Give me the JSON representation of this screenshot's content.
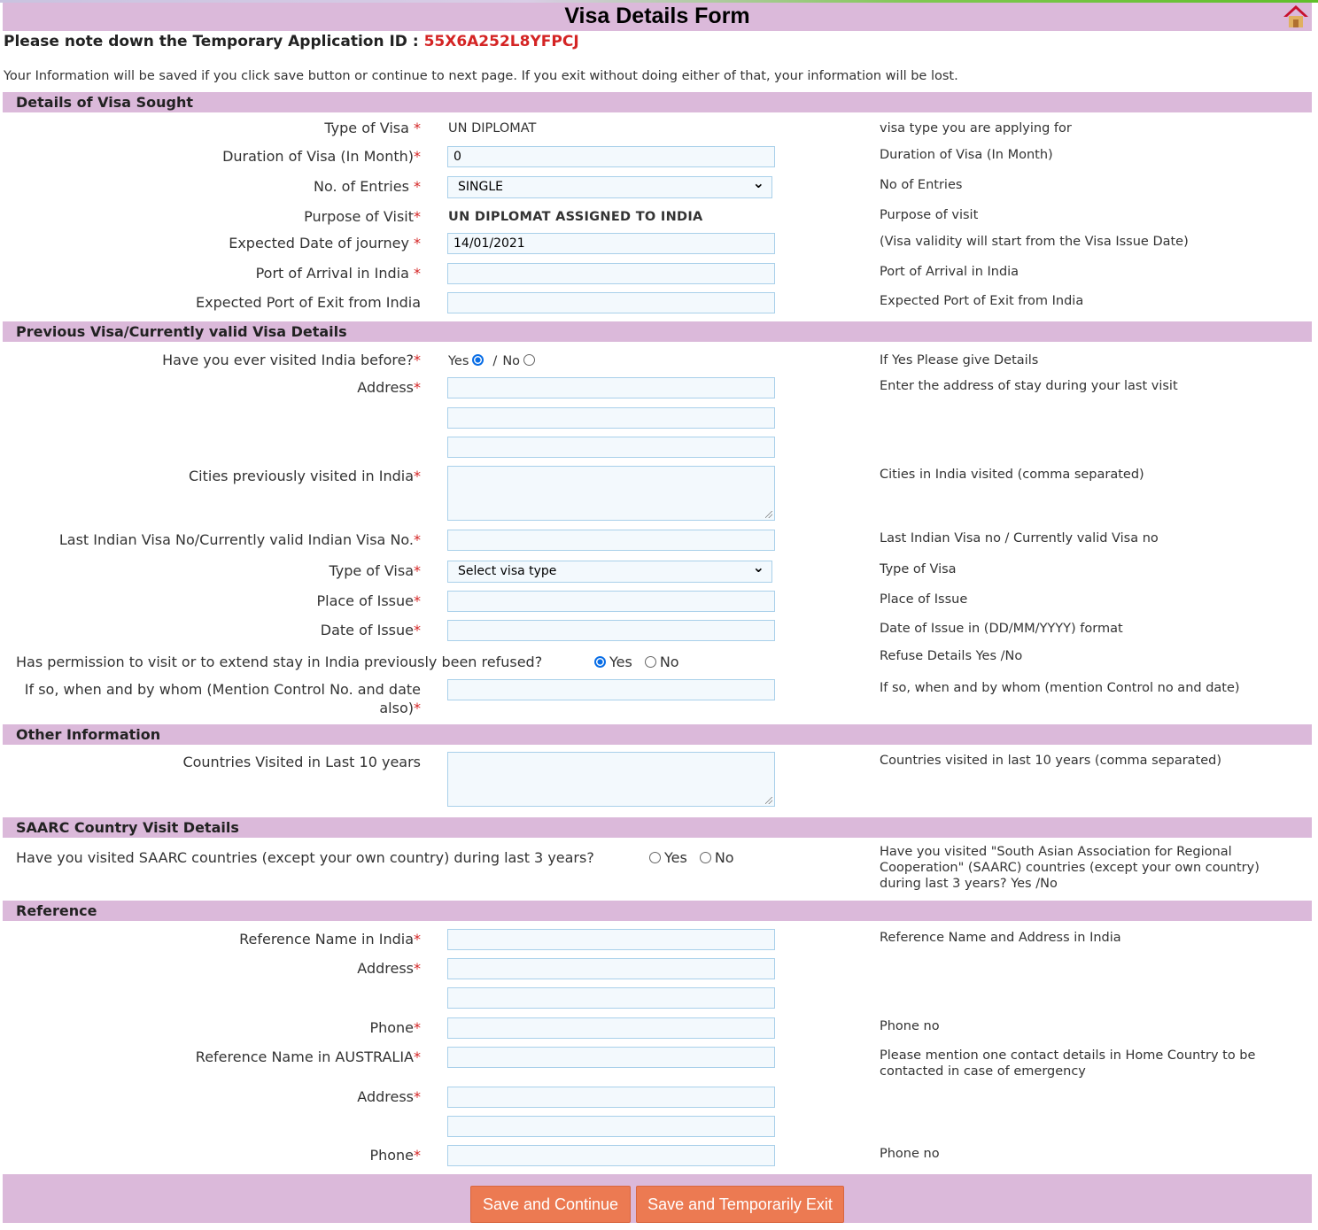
{
  "title": "Visa Details Form",
  "note": {
    "label": "Please note down the Temporary Application ID : ",
    "app_id": "55X6A252L8YFPCJ"
  },
  "info": "Your Information will be saved if you click save button or continue to next page. If you exit without doing either of that, your information will be lost.",
  "colors": {
    "header": "#dbb9da",
    "button": "#ec7a52",
    "required": "#d42424"
  },
  "sections": [
    {
      "title": "Details of Visa Sought",
      "rows": [
        {
          "label": "Type of Visa ",
          "req": "*",
          "field": {
            "type": "text",
            "value": "UN DIPLOMAT"
          },
          "help": "visa type you are applying for"
        },
        {
          "label": "Duration of Visa (In Month)",
          "req": "*",
          "field": {
            "type": "input",
            "value": "0"
          },
          "help": "Duration of Visa (In Month)"
        },
        {
          "label": "No. of Entries ",
          "req": "*",
          "field": {
            "type": "select",
            "value": "SINGLE"
          },
          "help": "No of Entries"
        },
        {
          "label": "Purpose of Visit",
          "req": "*",
          "field": {
            "type": "bold",
            "value": "UN DIPLOMAT ASSIGNED TO INDIA"
          },
          "help": "Purpose of visit"
        },
        {
          "label": "Expected Date of journey ",
          "req": "*",
          "field": {
            "type": "input",
            "value": "14/01/2021"
          },
          "help": "(Visa validity will start from the Visa Issue Date)"
        },
        {
          "label": "Port of Arrival in India ",
          "req": "*",
          "field": {
            "type": "input",
            "value": ""
          },
          "help": "Port of Arrival in India"
        },
        {
          "label": "Expected Port of Exit from India",
          "req": "",
          "field": {
            "type": "input",
            "value": ""
          },
          "help": "Expected Port of Exit from India"
        }
      ]
    },
    {
      "title": "Previous Visa/Currently valid Visa Details",
      "rows": [
        {
          "label": "Have you ever visited India before?",
          "req": "*",
          "field": {
            "type": "radio",
            "yes": "Yes",
            "no": "No",
            "sep": "/",
            "selected": "Yes"
          },
          "help": "If Yes Please give Details"
        },
        {
          "label": "Address",
          "req": "*",
          "field": {
            "type": "input",
            "value": ""
          },
          "help": "Enter the address of stay during your last visit"
        },
        {
          "label": "",
          "req": "",
          "field": {
            "type": "input",
            "value": ""
          },
          "help": ""
        },
        {
          "label": "",
          "req": "",
          "field": {
            "type": "input",
            "value": ""
          },
          "help": ""
        },
        {
          "label": "Cities previously visited in India",
          "req": "*",
          "field": {
            "type": "textarea",
            "value": ""
          },
          "help": "Cities in India visited (comma separated)"
        },
        {
          "label": "Last Indian Visa No/Currently valid Indian Visa No.",
          "req": "*",
          "field": {
            "type": "input",
            "value": ""
          },
          "help": "Last Indian Visa no / Currently valid Visa no"
        },
        {
          "label": "Type of Visa",
          "req": "*",
          "field": {
            "type": "select",
            "value": "Select visa type"
          },
          "help": "Type of Visa"
        },
        {
          "label": "Place of Issue",
          "req": "*",
          "field": {
            "type": "input",
            "value": ""
          },
          "help": "Place of Issue"
        },
        {
          "label": "Date of Issue",
          "req": "*",
          "field": {
            "type": "input",
            "value": ""
          },
          "help": "Date of Issue in (DD/MM/YYYY) format"
        },
        {
          "label": "Has permission to visit or to extend stay in India previously been refused?",
          "req": "",
          "wide": true,
          "field": {
            "type": "radio2",
            "yes": "Yes",
            "no": "No",
            "selected": "Yes"
          },
          "help": "Refuse Details Yes /No"
        },
        {
          "label": "If so, when and by whom (Mention Control No. and date also)",
          "req": "*",
          "field": {
            "type": "input",
            "value": ""
          },
          "help": "If so, when and by whom (mention Control no and date)"
        }
      ]
    },
    {
      "title": "Other Information",
      "rows": [
        {
          "label": "Countries Visited in Last 10 years",
          "req": "",
          "field": {
            "type": "textarea",
            "value": ""
          },
          "help": "Countries visited in last 10 years (comma separated)"
        }
      ]
    },
    {
      "title": "SAARC Country Visit Details",
      "rows": [
        {
          "label": "Have you visited SAARC countries (except your own country) during last 3 years?",
          "req": "",
          "wide": true,
          "field": {
            "type": "radio2",
            "yes": "Yes",
            "no": "No",
            "selected": ""
          },
          "help": "Have you visited \"South Asian Association for Regional Cooperation\" (SAARC) countries (except your own country) during last 3 years? Yes /No"
        }
      ]
    },
    {
      "title": "Reference",
      "rows": [
        {
          "label": "Reference Name in India",
          "req": "*",
          "field": {
            "type": "input",
            "value": ""
          },
          "help": "Reference Name and Address in India"
        },
        {
          "label": "Address",
          "req": "*",
          "field": {
            "type": "input",
            "value": ""
          },
          "help": ""
        },
        {
          "label": "",
          "req": "",
          "field": {
            "type": "input",
            "value": ""
          },
          "help": ""
        },
        {
          "label": "Phone",
          "req": "*",
          "field": {
            "type": "input",
            "value": ""
          },
          "help": "Phone no"
        },
        {
          "label": "Reference Name in AUSTRALIA",
          "req": "*",
          "field": {
            "type": "input",
            "value": ""
          },
          "help": "Please mention one contact details in Home Country to be contacted in case of emergency"
        },
        {
          "label": "Address",
          "req": "*",
          "field": {
            "type": "input",
            "value": ""
          },
          "help": ""
        },
        {
          "label": "",
          "req": "",
          "field": {
            "type": "input",
            "value": ""
          },
          "help": ""
        },
        {
          "label": "Phone",
          "req": "*",
          "field": {
            "type": "input",
            "value": ""
          },
          "help": "Phone no"
        }
      ]
    }
  ],
  "buttons": {
    "save_continue": "Save and Continue",
    "save_exit": "Save and Temporarily Exit"
  }
}
